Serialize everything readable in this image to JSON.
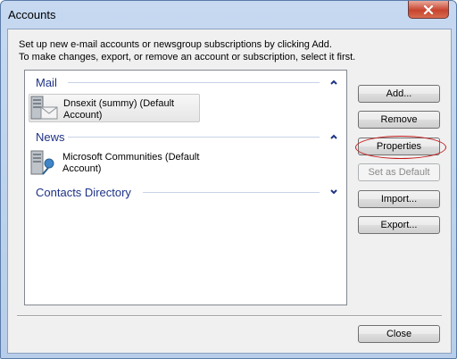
{
  "window": {
    "title": "Accounts",
    "close_glyph": "x"
  },
  "description": {
    "line1": "Set up new e-mail accounts or newsgroup subscriptions by clicking Add.",
    "line2": "To make changes, export, or remove an account or subscription, select it first."
  },
  "groups": {
    "mail": {
      "label": "Mail",
      "items": [
        {
          "line1": "Dnsexit (summy) (Default",
          "line2": "Account)"
        }
      ]
    },
    "news": {
      "label": "News",
      "items": [
        {
          "line1": "Microsoft Communities (Default",
          "line2": "Account)"
        }
      ]
    },
    "contacts": {
      "label": "Contacts Directory"
    }
  },
  "buttons": {
    "add": "Add...",
    "remove": "Remove",
    "properties": "Properties",
    "set_default": "Set as Default",
    "import": "Import...",
    "export": "Export...",
    "close": "Close"
  },
  "colors": {
    "group_header": "#1e3287",
    "highlight": "#c41a1a"
  }
}
